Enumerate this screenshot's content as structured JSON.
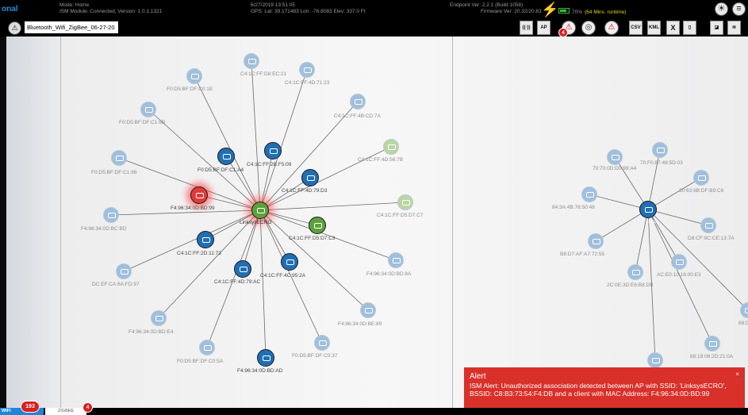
{
  "header": {
    "brand": "onal",
    "mode": "Mode: Home",
    "ism": "ISM Module: Connected, Version: 1.0.1.1321",
    "datetime": "6/27/2019 13:51:05",
    "gps": "GPS: Lat: 39.171483 Lon: -76.8083 Elev: 337.0 Ft",
    "endpoint": "Endpoint Ver: 2.2.1 (Build 1058)",
    "firmware": "Firmware Ver: 20.32/20.63",
    "battery_pct": "70%",
    "battery_runtime": "(64 Mins. runtime)"
  },
  "toolbar": {
    "project_name": "Bluetooth_Wifi_ZigBee_06-27-20",
    "alerts_badge": "4",
    "csv_label": "CSV",
    "kml_label": "KML",
    "ap_label": "AP",
    "close_label": "X"
  },
  "graph1": {
    "center": "LinksysECRO",
    "nodes": [
      {
        "label": "C4:1C:FF:D8:EC:21",
        "state": "faded"
      },
      {
        "label": "C4:1C:FF:4D:71:23",
        "state": "faded"
      },
      {
        "label": "F0:D5:BF:DF:C0:1E",
        "state": "faded"
      },
      {
        "label": "F0:D5:BF:DF:C1:8B",
        "state": "faded"
      },
      {
        "label": "C4:1C:FF:4B:CD:7A",
        "state": "faded"
      },
      {
        "label": "C4:1C:FF:4D:56:7B",
        "state": "faded-green"
      },
      {
        "label": "F0:D5:BF:DF:C1:86",
        "state": "faded"
      },
      {
        "label": "F0:D5:BF:DF:C1:A4",
        "state": "active"
      },
      {
        "label": "C4:1C:FF:2B:F5:09",
        "state": "active"
      },
      {
        "label": "C4:1C:FF:4D:79:D3",
        "state": "active"
      },
      {
        "label": "F4:96:34:0D:BD:99",
        "state": "alert"
      },
      {
        "label": "C4:1C:FF:D5:D7:C7",
        "state": "faded-green"
      },
      {
        "label": "F4:96:34:0D:BC:BD",
        "state": "faded"
      },
      {
        "label": "C4:1C:FF:D5:D7:C3",
        "state": "green"
      },
      {
        "label": "C4:1C:FF:2D:11:73",
        "state": "active"
      },
      {
        "label": "F4:96:34:0D:BD:8A",
        "state": "faded"
      },
      {
        "label": "C4:1C:FF:4C:95:2A",
        "state": "active"
      },
      {
        "label": "DC:EF:CA:6A:FD:97",
        "state": "faded"
      },
      {
        "label": "C4:1C:FF:4D:79:AC",
        "state": "active"
      },
      {
        "label": "F4:96:34:0D:BE:89",
        "state": "faded"
      },
      {
        "label": "F4:96:34:0D:BD:E4",
        "state": "faded"
      },
      {
        "label": "F0:D5:BF:DF:C0:37",
        "state": "faded"
      },
      {
        "label": "F0:D5:BF:DF:C0:5A",
        "state": "faded"
      },
      {
        "label": "F4:96:34:0D:BD:AD",
        "state": "active"
      }
    ]
  },
  "graph2": {
    "center": "corp",
    "nodes": [
      {
        "label": "70:70:0D:D0:99:A4"
      },
      {
        "label": "70:F0:87:49:5D:03"
      },
      {
        "label": "30:63:6B:DF:B9:C6"
      },
      {
        "label": "84:3A:4B:76:50:48"
      },
      {
        "label": "D8:CF:9C:CE:13:7A"
      },
      {
        "label": "B8:D7:AF:A7:72:55"
      },
      {
        "label": "AC:E0:10:16:00:E3"
      },
      {
        "label": "2C:0E:3D:E6:B8:DB"
      },
      {
        "label": "68:D"
      },
      {
        "label": "88:19:08:2D:21:0A"
      },
      {
        "label": ""
      }
    ]
  },
  "tabs": {
    "wifi_label": "WIFI",
    "wifi_count": "193",
    "zigbee_label": "ZIGBEE",
    "zigbee_count": "4"
  },
  "alert": {
    "title": "Alert",
    "message": "ISM Alert: Unauthorized association detected between AP with SSID: 'LinksysECRO', BSSID: C8:B3:73:54:F4:DB and a client with MAC Address: F4:96:34:0D:BD:99",
    "close": "×"
  },
  "colors": {
    "active": "#1f6fb4",
    "faded": "#9fbfdc",
    "green": "#5da13a",
    "faded_green": "#b9d6a3",
    "alert_node": "#e23a3a",
    "alert_panel": "#d9302a",
    "wifi_tab": "#1e87d8"
  }
}
